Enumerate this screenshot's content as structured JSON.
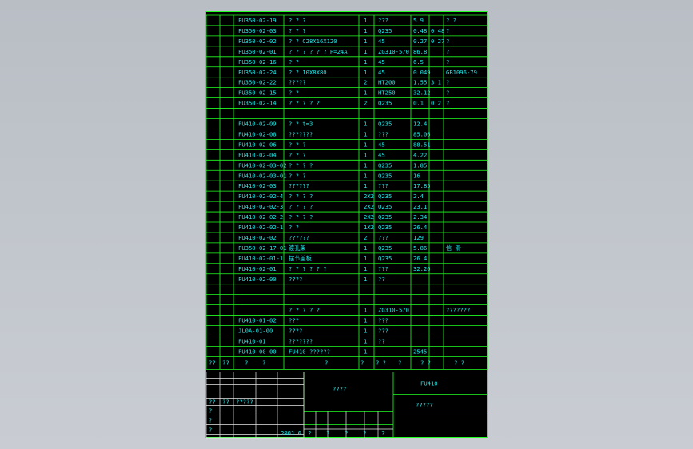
{
  "rows": [
    [
      "FU350-02-19",
      "? ? ?",
      "1",
      "???",
      "5.9",
      "",
      "? ?"
    ],
    [
      "FU350-02-03",
      "? ? ?",
      "1",
      "Q235",
      "0.48",
      "0.48",
      "?"
    ],
    [
      "FU350-02-02",
      "? ?  C28X16X120",
      "1",
      "45",
      "0.27",
      "0.27",
      "?"
    ],
    [
      "FU350-02-01",
      "? ? ? ? ? ?  P=24A",
      "1",
      "ZG310-570",
      "86.8",
      "",
      "?"
    ],
    [
      "FU350-02-16",
      "? ?",
      "1",
      "45",
      "6.5",
      "",
      "?"
    ],
    [
      "FU350-02-24",
      "? ?  10X8X80",
      "1",
      "45",
      "0.049",
      "",
      "GB1096-79"
    ],
    [
      "FU350-02-22",
      "?????",
      "2",
      "HT200",
      "1.55",
      "3.1",
      "?"
    ],
    [
      "FU350-02-15",
      "? ?",
      "1",
      "HT250",
      "32.12",
      "",
      "?"
    ],
    [
      "FU350-02-14",
      "? ? ? ? ?",
      "2",
      "Q235",
      "0.1",
      "0.2",
      "?"
    ],
    [
      "",
      "",
      "",
      "",
      "",
      "",
      ""
    ],
    [
      "FU410-02-09",
      "? ?  t=3",
      "1",
      "Q235",
      "12.4",
      "",
      ""
    ],
    [
      "FU410-02-08",
      "???????",
      "1",
      "???",
      "85.06",
      "",
      ""
    ],
    [
      "FU410-02-06",
      "? ? ?",
      "1",
      "45",
      "88.51",
      "",
      ""
    ],
    [
      "FU410-02-04",
      "? ? ?",
      "1",
      "45",
      "4.22",
      "",
      ""
    ],
    [
      "FU410-02-03-02",
      "? ? ? ?",
      "1",
      "Q235",
      "1.85",
      "",
      ""
    ],
    [
      "FU410-02-03-01",
      "? ? ?",
      "1",
      "Q235",
      "16",
      "",
      ""
    ],
    [
      "FU410-02-03",
      "??????",
      "1",
      "???",
      "17.85",
      "",
      ""
    ],
    [
      "FU410-02-02-4",
      "? ? ? ?",
      "2X2",
      "Q235",
      "2.4",
      "",
      ""
    ],
    [
      "FU410-02-02-3",
      "? ? ? ?",
      "2X2",
      "Q235",
      "23.1",
      "",
      ""
    ],
    [
      "FU410-02-02-2",
      "? ? ? ?",
      "2X2",
      "Q235",
      "2.34",
      "",
      ""
    ],
    [
      "FU410-02-02-1",
      "? ?",
      "1X2",
      "Q235",
      "26.4",
      "",
      ""
    ],
    [
      "FU410-02-02",
      "??????",
      "2",
      "???",
      "129",
      "",
      ""
    ],
    [
      "FU350-02-17-01",
      "渡孔架",
      "1",
      "Q235",
      "5.86",
      "",
      "信 滑"
    ],
    [
      "FU410-02-01-1",
      "摆节盖板",
      "1",
      "Q235",
      "26.4",
      "",
      ""
    ],
    [
      "FU410-02-01",
      "? ? ? ? ? ?",
      "1",
      "???",
      "32.26",
      "",
      ""
    ],
    [
      "FU410-02-00",
      "????",
      "1",
      "??",
      "",
      "",
      ""
    ],
    [
      "",
      "",
      "",
      "",
      "",
      "",
      ""
    ],
    [
      "",
      "",
      "",
      "",
      "",
      "",
      ""
    ],
    [
      "",
      "? ? ? ? ?",
      "1",
      "ZG310-570",
      "",
      "",
      "???????"
    ],
    [
      "FU410-01-02",
      "???",
      "1",
      "???",
      "",
      "",
      ""
    ],
    [
      "JL0A-01-00",
      "????",
      "1",
      "???",
      "",
      "",
      ""
    ],
    [
      "FU410-01",
      "???????",
      "1",
      "??",
      "",
      "",
      ""
    ],
    [
      "FU410-00-00",
      "FU410 ??????",
      "1",
      "",
      "2545",
      "",
      ""
    ]
  ],
  "header": [
    "??",
    "??",
    "?",
    "?",
    "?",
    "?",
    "? ?",
    "?",
    "? ?",
    "? ?"
  ],
  "title_block": {
    "name": "????",
    "drawing_no": "FU410",
    "company": "?????",
    "sign_labels": [
      "??",
      "??",
      "?????",
      "?",
      "?",
      "?"
    ],
    "date": "2001.6",
    "marks": [
      "?",
      "?",
      "?",
      "?",
      "?"
    ]
  }
}
